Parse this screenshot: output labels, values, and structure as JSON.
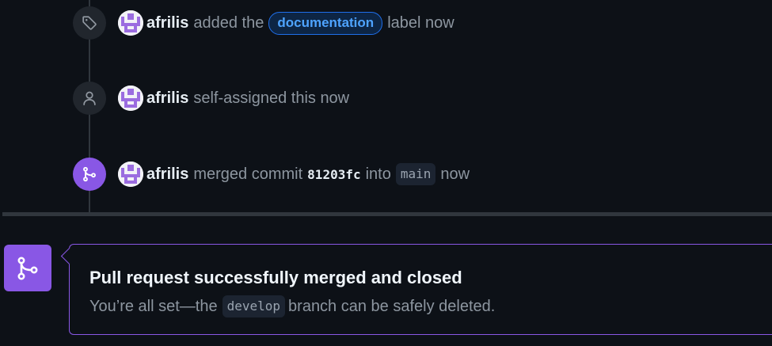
{
  "timeline": {
    "events": [
      {
        "icon": "tag-icon",
        "actor": "afrilis",
        "pre_text": "added the",
        "label": "documentation",
        "post_text": "label now"
      },
      {
        "icon": "person-icon",
        "actor": "afrilis",
        "text": "self-assigned this now"
      },
      {
        "icon": "git-merge-icon",
        "actor": "afrilis",
        "pre_text": "merged commit",
        "commit": "81203fc",
        "mid_text": "into",
        "branch": "main",
        "post_text": "now"
      }
    ]
  },
  "merge_status": {
    "icon": "git-merge-icon",
    "title": "Pull request successfully merged and closed",
    "desc_before": "You’re all set—the",
    "branch": "develop",
    "desc_after": "branch can be safely deleted."
  },
  "colors": {
    "background": "#0d1117",
    "merged_purple": "#8957e5",
    "label_blue": "#4ea3ff",
    "muted_text": "#8d96a0"
  }
}
